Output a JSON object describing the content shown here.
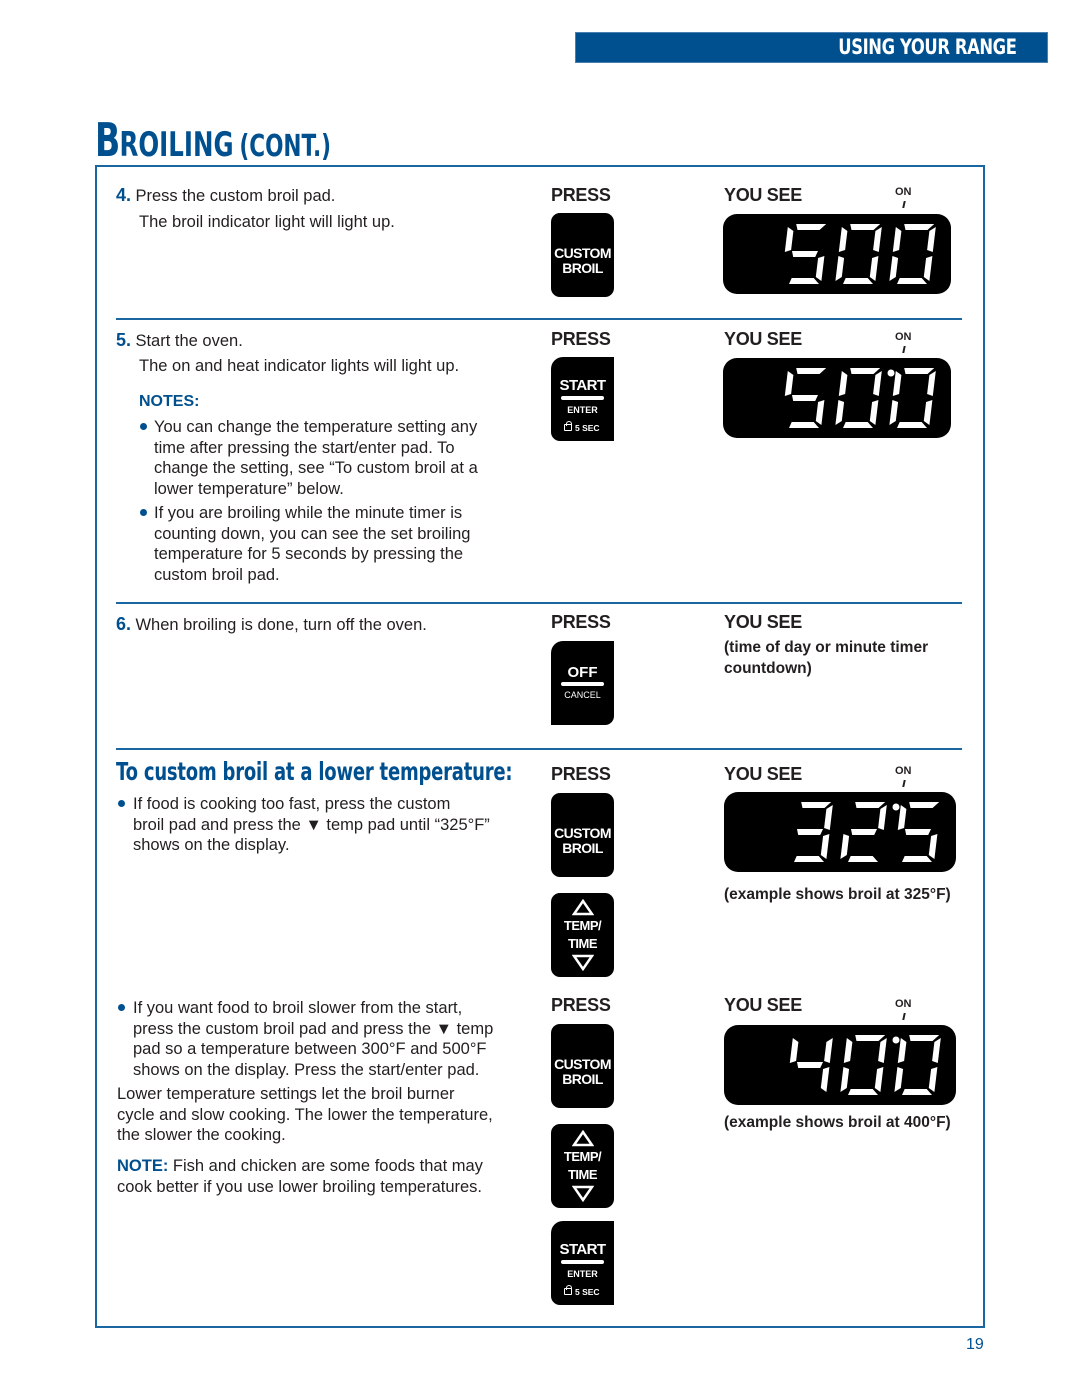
{
  "header": {
    "section_label": "USING YOUR RANGE"
  },
  "title": {
    "main_cap": "B",
    "main_rest": "ROILING",
    "suffix": "(CONT.)"
  },
  "columns": {
    "press": "PRESS",
    "you_see": "YOU SEE",
    "on_indicator": "ON"
  },
  "steps": [
    {
      "number": "4.",
      "lines": [
        "Press the custom broil pad.",
        "The broil indicator light will light up."
      ],
      "pad": {
        "type": "custom-broil",
        "line1": "CUSTOM",
        "line2": "BROIL"
      },
      "display": {
        "digits": "500",
        "dot": false,
        "on_indicator": true
      }
    },
    {
      "number": "5.",
      "lines": [
        "Start the oven.",
        "The on and heat indicator lights will light up."
      ],
      "notes_label": "NOTES:",
      "notes": [
        [
          "You can change the temperature setting any",
          "time after pressing the start/enter pad. To",
          "change the setting, see “To custom broil at a",
          "lower temperature” below."
        ],
        [
          "If you are broiling while the minute timer is",
          "counting down, you can see the set broiling",
          "temperature for 5 seconds by pressing the",
          "custom broil pad."
        ]
      ],
      "pad": {
        "type": "start",
        "line1": "START",
        "line2": "ENTER",
        "line3": "5 SEC"
      },
      "display": {
        "digits": "500",
        "dot": true,
        "on_indicator": true
      }
    },
    {
      "number": "6.",
      "lines": [
        "When broiling is done, turn off the oven."
      ],
      "pad": {
        "type": "off",
        "line1": "OFF",
        "line2": "CANCEL"
      },
      "you_see_text": [
        "(time of day or minute timer",
        "countdown)"
      ]
    }
  ],
  "lower_temp": {
    "title": "To custom broil at a lower temperature:",
    "bullet1": [
      "If food is cooking too fast, press the custom",
      "broil pad and press the ▼ temp pad until “325°F”",
      "shows on the display."
    ],
    "bullet2": [
      "If you want food to broil slower from the start,",
      "press the custom broil pad and press the ▼ temp",
      "pad so a temperature between 300°F and 500°F",
      "shows on the display. Press the start/enter pad."
    ],
    "paragraph": [
      "Lower temperature settings let the broil burner",
      "cycle and slow cooking. The lower the temperature,",
      "the slower the cooking."
    ],
    "note_label": "NOTE:",
    "note_text": [
      " Fish and chicken are some foods that may",
      "cook better if you use lower broiling temperatures."
    ],
    "example1": {
      "digits": "325",
      "caption": "(example shows broil at 325°F)"
    },
    "example2": {
      "digits": "400",
      "caption": "(example shows broil at 400°F)"
    },
    "temp_pad": {
      "line1": "TEMP/",
      "line2": "TIME"
    }
  },
  "page_number": "19",
  "colors": {
    "brand_blue": "#00508f",
    "rule_blue": "#1a66a0",
    "text": "#231f20"
  }
}
